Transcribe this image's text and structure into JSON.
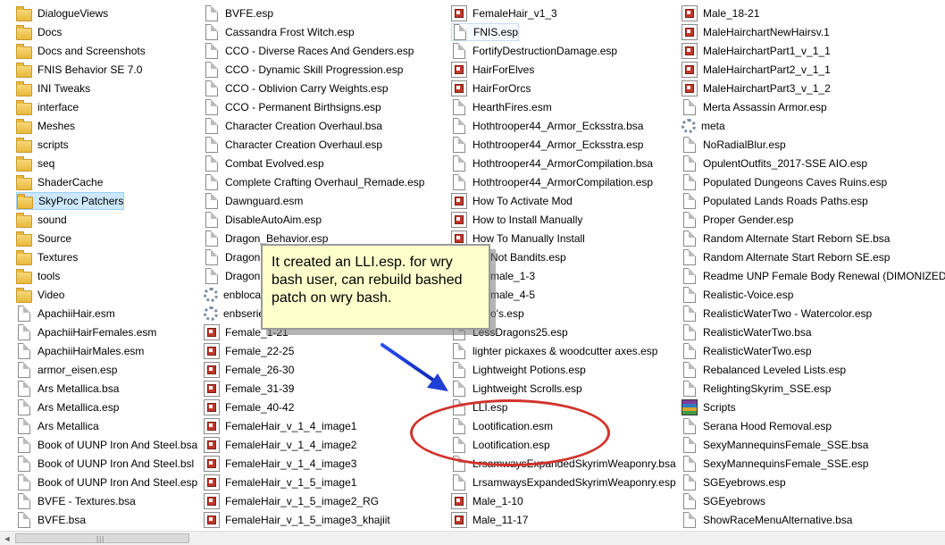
{
  "columns": [
    {
      "items": [
        {
          "label": "DialogueViews",
          "icon": "folder-icon"
        },
        {
          "label": "Docs",
          "icon": "folder-icon"
        },
        {
          "label": "Docs and Screenshots",
          "icon": "folder-icon"
        },
        {
          "label": "FNIS Behavior SE 7.0",
          "icon": "folder-icon"
        },
        {
          "label": "INI Tweaks",
          "icon": "folder-icon"
        },
        {
          "label": "interface",
          "icon": "folder-icon"
        },
        {
          "label": "Meshes",
          "icon": "folder-icon"
        },
        {
          "label": "scripts",
          "icon": "folder-icon"
        },
        {
          "label": "seq",
          "icon": "folder-icon"
        },
        {
          "label": "ShaderCache",
          "icon": "folder-icon"
        },
        {
          "label": "SkyProc Patchers",
          "icon": "folder-icon",
          "state": "selected"
        },
        {
          "label": "sound",
          "icon": "folder-icon"
        },
        {
          "label": "Source",
          "icon": "folder-icon"
        },
        {
          "label": "Textures",
          "icon": "folder-icon"
        },
        {
          "label": "tools",
          "icon": "folder-icon"
        },
        {
          "label": "Video",
          "icon": "folder-icon"
        },
        {
          "label": "ApachiiHair.esm",
          "icon": "file-icon"
        },
        {
          "label": "ApachiiHairFemales.esm",
          "icon": "file-icon"
        },
        {
          "label": "ApachiiHairMales.esm",
          "icon": "file-icon"
        },
        {
          "label": "armor_eisen.esp",
          "icon": "file-icon"
        },
        {
          "label": "Ars Metallica.bsa",
          "icon": "file-icon"
        },
        {
          "label": "Ars Metallica.esp",
          "icon": "file-icon"
        },
        {
          "label": "Ars Metallica",
          "icon": "file-icon"
        },
        {
          "label": "Book of UUNP Iron And Steel.bsa",
          "icon": "file-icon"
        },
        {
          "label": "Book of UUNP Iron And Steel.bsl",
          "icon": "file-icon"
        },
        {
          "label": "Book of UUNP Iron And Steel.esp",
          "icon": "file-icon"
        },
        {
          "label": "BVFE - Textures.bsa",
          "icon": "file-icon"
        },
        {
          "label": "BVFE.bsa",
          "icon": "file-icon"
        }
      ]
    },
    {
      "items": [
        {
          "label": "BVFE.esp",
          "icon": "file-icon"
        },
        {
          "label": "Cassandra Frost Witch.esp",
          "icon": "file-icon"
        },
        {
          "label": "CCO - Diverse Races And Genders.esp",
          "icon": "file-icon"
        },
        {
          "label": "CCO - Dynamic Skill Progression.esp",
          "icon": "file-icon"
        },
        {
          "label": "CCO - Oblivion Carry Weights.esp",
          "icon": "file-icon"
        },
        {
          "label": "CCO - Permanent Birthsigns.esp",
          "icon": "file-icon"
        },
        {
          "label": "Character Creation Overhaul.bsa",
          "icon": "file-icon"
        },
        {
          "label": "Character Creation Overhaul.esp",
          "icon": "file-icon"
        },
        {
          "label": "Combat Evolved.esp",
          "icon": "file-icon"
        },
        {
          "label": "Complete Crafting Overhaul_Remade.esp",
          "icon": "file-icon"
        },
        {
          "label": "Dawnguard.esm",
          "icon": "file-icon"
        },
        {
          "label": "DisableAutoAim.esp",
          "icon": "file-icon"
        },
        {
          "label": "Dragon_Behavior.esp",
          "icon": "file-icon"
        },
        {
          "label": "Dragonb",
          "icon": "file-icon"
        },
        {
          "label": "Dragonb",
          "icon": "file-icon"
        },
        {
          "label": "enbloca",
          "icon": "gear-icon"
        },
        {
          "label": "enbserie",
          "icon": "gear-icon"
        },
        {
          "label": "Female_1-21",
          "icon": "image-icon"
        },
        {
          "label": "Female_22-25",
          "icon": "image-icon"
        },
        {
          "label": "Female_26-30",
          "icon": "image-icon"
        },
        {
          "label": "Female_31-39",
          "icon": "image-icon"
        },
        {
          "label": "Female_40-42",
          "icon": "image-icon"
        },
        {
          "label": "FemaleHair_v_1_4_image1",
          "icon": "image-icon"
        },
        {
          "label": "FemaleHair_v_1_4_image2",
          "icon": "image-icon"
        },
        {
          "label": "FemaleHair_v_1_4_image3",
          "icon": "image-icon"
        },
        {
          "label": "FemaleHair_v_1_5_image1",
          "icon": "image-icon"
        },
        {
          "label": "FemaleHair_v_1_5_image2_RG",
          "icon": "image-icon"
        },
        {
          "label": "FemaleHair_v_1_5_image3_khajiit",
          "icon": "image-icon"
        }
      ]
    },
    {
      "items": [
        {
          "label": "FemaleHair_v1_3",
          "icon": "image-icon"
        },
        {
          "label": "FNIS.esp",
          "icon": "file-icon",
          "state": "focused"
        },
        {
          "label": "FortifyDestructionDamage.esp",
          "icon": "file-icon"
        },
        {
          "label": "HairForElves",
          "icon": "image-icon"
        },
        {
          "label": "HairForOrcs",
          "icon": "image-icon"
        },
        {
          "label": "HearthFires.esm",
          "icon": "file-icon"
        },
        {
          "label": "Hothtrooper44_Armor_Ecksstra.bsa",
          "icon": "file-icon"
        },
        {
          "label": "Hothtrooper44_Armor_Ecksstra.esp",
          "icon": "file-icon"
        },
        {
          "label": "Hothtrooper44_ArmorCompilation.bsa",
          "icon": "file-icon"
        },
        {
          "label": "Hothtrooper44_ArmorCompilation.esp",
          "icon": "file-icon"
        },
        {
          "label": "How To Activate Mod",
          "icon": "image-icon"
        },
        {
          "label": "How to Install Manually",
          "icon": "image-icon"
        },
        {
          "label": "How To Manually Install",
          "icon": "image-icon"
        },
        {
          "label": "ers Not Bandits.esp",
          "icon": "file-icon"
        },
        {
          "label": "itFemale_1-3",
          "icon": "image-icon"
        },
        {
          "label": "itFemale_4-5",
          "icon": "image-icon"
        },
        {
          "label": "airdo's.esp",
          "icon": "file-icon"
        },
        {
          "label": "LessDragons25.esp",
          "icon": "file-icon"
        },
        {
          "label": "lighter pickaxes & woodcutter axes.esp",
          "icon": "file-icon"
        },
        {
          "label": "Lightweight Potions.esp",
          "icon": "file-icon"
        },
        {
          "label": "Lightweight Scrolls.esp",
          "icon": "file-icon"
        },
        {
          "label": "LLI.esp",
          "icon": "file-icon"
        },
        {
          "label": "Lootification.esm",
          "icon": "file-icon"
        },
        {
          "label": "Lootification.esp",
          "icon": "file-icon"
        },
        {
          "label": "LrsamwaysExpandedSkyrimWeaponry.bsa",
          "icon": "file-icon"
        },
        {
          "label": "LrsamwaysExpandedSkyrimWeaponry.esp",
          "icon": "file-icon"
        },
        {
          "label": "Male_1-10",
          "icon": "image-icon"
        },
        {
          "label": "Male_11-17",
          "icon": "image-icon"
        }
      ]
    },
    {
      "items": [
        {
          "label": "Male_18-21",
          "icon": "image-icon"
        },
        {
          "label": "MaleHairchartNewHairsv.1",
          "icon": "image-icon"
        },
        {
          "label": "MaleHairchartPart1_v_1_1",
          "icon": "image-icon"
        },
        {
          "label": "MaleHairchartPart2_v_1_1",
          "icon": "image-icon"
        },
        {
          "label": "MaleHairchartPart3_v_1_2",
          "icon": "image-icon"
        },
        {
          "label": "Merta Assassin Armor.esp",
          "icon": "file-icon"
        },
        {
          "label": "meta",
          "icon": "gear-icon"
        },
        {
          "label": "NoRadialBlur.esp",
          "icon": "file-icon"
        },
        {
          "label": "OpulentOutfits_2017-SSE AIO.esp",
          "icon": "file-icon"
        },
        {
          "label": "Populated Dungeons Caves Ruins.esp",
          "icon": "file-icon"
        },
        {
          "label": "Populated Lands Roads Paths.esp",
          "icon": "file-icon"
        },
        {
          "label": "Proper Gender.esp",
          "icon": "file-icon"
        },
        {
          "label": "Random Alternate Start Reborn SE.bsa",
          "icon": "file-icon"
        },
        {
          "label": "Random Alternate Start Reborn SE.esp",
          "icon": "file-icon"
        },
        {
          "label": "Readme UNP Female Body Renewal (DIMONIZED UN",
          "icon": "file-icon"
        },
        {
          "label": "Realistic-Voice.esp",
          "icon": "file-icon"
        },
        {
          "label": "RealisticWaterTwo - Watercolor.esp",
          "icon": "file-icon"
        },
        {
          "label": "RealisticWaterTwo.bsa",
          "icon": "file-icon"
        },
        {
          "label": "RealisticWaterTwo.esp",
          "icon": "file-icon"
        },
        {
          "label": "Rebalanced Leveled Lists.esp",
          "icon": "file-icon"
        },
        {
          "label": "RelightingSkyrim_SSE.esp",
          "icon": "file-icon"
        },
        {
          "label": "Scripts",
          "icon": "archive-icon"
        },
        {
          "label": "Serana Hood Removal.esp",
          "icon": "file-icon"
        },
        {
          "label": "SexyMannequinsFemale_SSE.bsa",
          "icon": "file-icon"
        },
        {
          "label": "SexyMannequinsFemale_SSE.esp",
          "icon": "file-icon"
        },
        {
          "label": "SGEyebrows.esp",
          "icon": "file-icon"
        },
        {
          "label": "SGEyebrows",
          "icon": "file-icon"
        },
        {
          "label": "ShowRaceMenuAlternative.bsa",
          "icon": "file-icon"
        }
      ]
    }
  ],
  "annotation": {
    "callout_text": "It created an LLI.esp. for wry bash user, can rebuild bashed patch on wry bash.",
    "colors": {
      "callout_bg": "#ffffcc",
      "ellipse": "#d0342c",
      "arrow": "#1f3fd6"
    }
  },
  "scrollbar": {
    "left_arrow": "◄",
    "grip": "|||"
  }
}
